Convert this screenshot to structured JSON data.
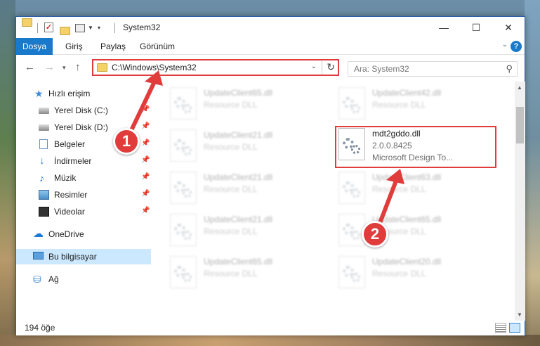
{
  "window": {
    "title": "System32"
  },
  "titlebar": {
    "minimize_glyph": "—",
    "maximize_glyph": "☐",
    "close_glyph": "✕"
  },
  "ribbon": {
    "tabs": [
      {
        "label": "Dosya"
      },
      {
        "label": "Giriş"
      },
      {
        "label": "Paylaş"
      },
      {
        "label": "Görünüm"
      }
    ],
    "help_glyph": "?"
  },
  "nav": {
    "address": "C:\\Windows\\System32",
    "search_placeholder": "Ara: System32"
  },
  "sidebar": {
    "items": [
      {
        "label": "Hızlı erişim",
        "icon": "star-icon"
      },
      {
        "label": "Yerel Disk (C:)",
        "icon": "disk-icon",
        "pinned": true
      },
      {
        "label": "Yerel Disk (D:)",
        "icon": "disk-icon",
        "pinned": true
      },
      {
        "label": "Belgeler",
        "icon": "document-icon",
        "pinned": true
      },
      {
        "label": "İndirmeler",
        "icon": "download-icon",
        "pinned": true
      },
      {
        "label": "Müzik",
        "icon": "music-icon",
        "pinned": true
      },
      {
        "label": "Resimler",
        "icon": "pictures-icon",
        "pinned": true
      },
      {
        "label": "Videolar",
        "icon": "video-icon",
        "pinned": true
      },
      {
        "label": "OneDrive",
        "icon": "cloud-icon"
      },
      {
        "label": "Bu bilgisayar",
        "icon": "computer-icon",
        "selected": true
      },
      {
        "label": "Ağ",
        "icon": "network-icon"
      }
    ]
  },
  "files": [
    {
      "name": "UpdateClient65.dll",
      "type": "Resource DLL",
      "blurred": true
    },
    {
      "name": "UpdateClient42.dll",
      "type": "Resource DLL",
      "blurred": true
    },
    {
      "name": "UpdateClient21.dll",
      "type": "Resource DLL",
      "blurred": true
    },
    {
      "name": "mdt2gddo.dll",
      "type": "2.0.0.8425",
      "desc": "Microsoft Design To...",
      "blurred": false,
      "highlighted": true
    },
    {
      "name": "UpdateClient21.dll",
      "type": "Resource DLL",
      "blurred": true
    },
    {
      "name": "UpdateClient63.dll",
      "type": "Resource DLL",
      "blurred": true
    },
    {
      "name": "UpdateClient21.dll",
      "type": "Resource DLL",
      "blurred": true
    },
    {
      "name": "UpdateClient65.dll",
      "type": "Resource DLL",
      "blurred": true
    },
    {
      "name": "UpdateClient65.dll",
      "type": "Resource DLL",
      "blurred": true
    },
    {
      "name": "UpdateClient20.dll",
      "type": "Resource DLL",
      "blurred": true
    }
  ],
  "status": {
    "item_count": "194 öğe"
  },
  "annotations": {
    "callout_1": "1",
    "callout_2": "2",
    "color": "#e03c3c"
  }
}
